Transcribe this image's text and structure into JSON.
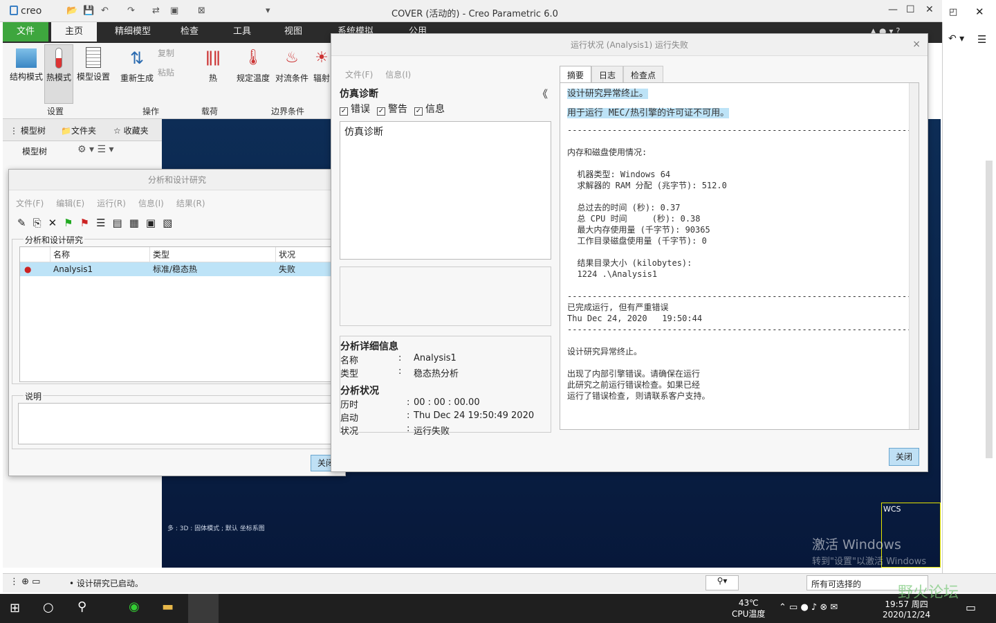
{
  "app": {
    "logo": "creo",
    "title": "COVER (活动的) - Creo Parametric 6.0",
    "restore": "◰",
    "close": "✕",
    "minimize": "—",
    "maximize": "☐"
  },
  "ribbon": {
    "tabs": [
      "文件",
      "主页",
      "精细模型",
      "检查",
      "工具",
      "视图",
      "系统模拟",
      "公用"
    ],
    "buttons": [
      "结构模式",
      "热模式",
      "模型设置",
      "重新生成",
      "复制",
      "粘贴",
      "热",
      "规定温度",
      "对流条件",
      "辐射"
    ],
    "groups": [
      "设置",
      "操作",
      "载荷",
      "边界条件"
    ]
  },
  "left": {
    "tabs": [
      "模型树",
      "文件夹",
      "收藏夹"
    ],
    "tree_label": "模型树"
  },
  "analysis": {
    "title": "分析和设计研究",
    "close": "×",
    "menu": [
      "文件(F)",
      "编辑(E)",
      "运行(R)",
      "信息(I)",
      "结果(R)"
    ],
    "group_label": "分析和设计研究",
    "columns": [
      "名称",
      "类型",
      "状况"
    ],
    "rows": [
      {
        "name": "Analysis1",
        "type": "标准/稳态热",
        "status": "失败"
      }
    ],
    "desc_label": "说明",
    "close_btn": "关闭"
  },
  "run": {
    "title": "运行状况 (Analysis1) 运行失败",
    "close": "×",
    "menu": [
      "文件(F)",
      "信息(I)"
    ],
    "diag_title": "仿真诊断",
    "collapse": "《",
    "filters": [
      "错误",
      "警告",
      "信息"
    ],
    "diag_text": "仿真诊断",
    "details_title": "分析详细信息",
    "details": [
      {
        "k": "名称",
        "v": "Analysis1"
      },
      {
        "k": "类型",
        "v": "稳态热分析"
      }
    ],
    "status_title": "分析状况",
    "status": [
      {
        "k": "历时",
        "v": "00 : 00 : 00.00"
      },
      {
        "k": "启动",
        "v": "Thu Dec 24 19:50:49 2020"
      },
      {
        "k": "状况",
        "v": "运行失败"
      }
    ],
    "tabs": [
      "摘要",
      "日志",
      "检查点"
    ],
    "summary_hl1": "设计研究异常终止。",
    "summary_hl2": "用于运行 MEC/热引擎的许可证不可用。",
    "summary_body": "------------------------------------------------------------------------\n\n内存和磁盘使用情况:\n\n  机器类型: Windows 64\n  求解器的 RAM 分配 (兆字节): 512.0\n\n  总过去的时间 (秒): 0.37\n  总 CPU 时间     (秒): 0.38\n  最大内存使用量 (千字节): 90365\n  工作目录磁盘使用量 (千字节): 0\n\n  结果目录大小 (kilobytes):\n  1224 .\\Analysis1\n\n------------------------------------------------------------------------\n已完成运行, 但有严重错误\nThu Dec 24, 2020   19:50:44\n------------------------------------------------------------------------\n\n设计研究异常终止。\n\n出现了内部引擎错误。请确保在运行\n此研究之前运行错误检查。如果已经\n运行了错误检查, 则请联系客户支持。",
    "close_btn": "关闭"
  },
  "viewport": {
    "caption": "多 : 3D : 固体模式 ; 默认 坐标系图",
    "wcs": "WCS",
    "watermark1": "激活 Windows",
    "watermark2": "转到\"设置\"以激活 Windows"
  },
  "status": {
    "message": "设计研究已启动。",
    "filter": "所有可选择的"
  },
  "taskbar": {
    "temp": "43℃",
    "temp_label": "CPU温度",
    "time": "19:57 周四",
    "date": "2020/12/24",
    "forum": "野火论坛"
  }
}
